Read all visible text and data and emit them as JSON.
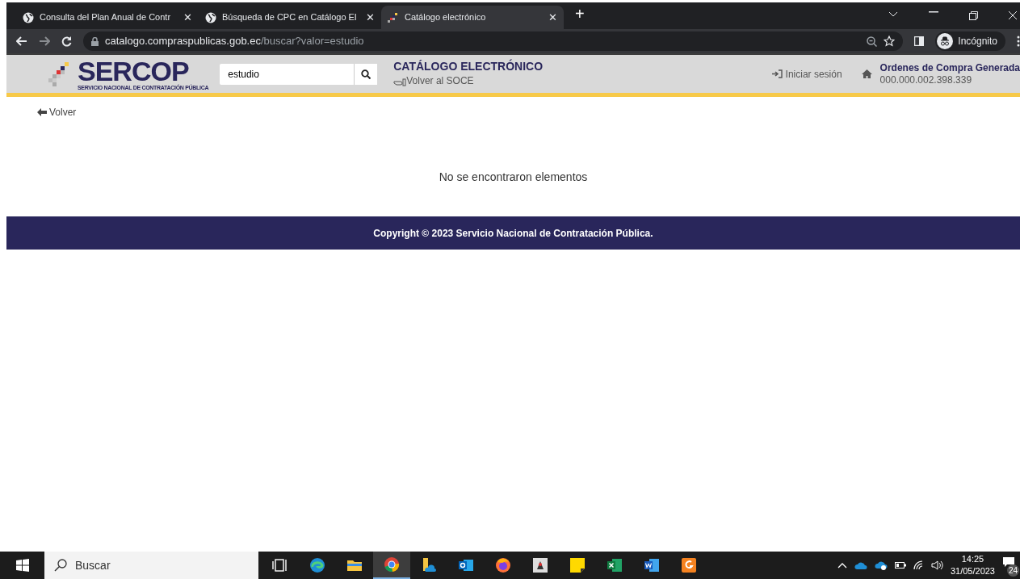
{
  "browser": {
    "tabs": [
      {
        "title": "Consulta del Plan Anual de Contr",
        "close": "✕",
        "selected": false
      },
      {
        "title": "Búsqueda de CPC en Catálogo El",
        "close": "✕",
        "selected": false
      },
      {
        "title": "Catálogo electrónico",
        "close": "✕",
        "selected": true
      }
    ],
    "new_tab": "+",
    "url_host": "catalogo.compraspublicas.gob.ec",
    "url_path": "/buscar?valor=estudio",
    "profile": "Incógnito"
  },
  "header": {
    "logo": "SERCOP",
    "logo_subtitle": "SERVICIO NACIONAL DE CONTRATACIÓN PÚBLICA",
    "search": {
      "value": "estudio"
    },
    "title": "CATÁLOGO ELECTRÓNICO",
    "back_link": "Volver al SOCE",
    "login": "Iniciar sesión",
    "orders_label": "Ordenes de Compra Generada",
    "orders_value": "000.000.002.398.339"
  },
  "back": "Volver",
  "message": "No se encontraron elementos",
  "footer": "Copyright © 2023 Servicio Nacional de Contratación Pública.",
  "taskbar": {
    "search_placeholder": "Buscar",
    "apps": [
      {
        "kind": "taskview",
        "selected": false
      },
      {
        "kind": "edge",
        "selected": false
      },
      {
        "kind": "folder",
        "selected": false
      },
      {
        "kind": "chrome",
        "selected": true
      },
      {
        "kind": "cloudfolder",
        "selected": false
      },
      {
        "kind": "outlook",
        "selected": false
      },
      {
        "kind": "firefox",
        "selected": false
      },
      {
        "kind": "java",
        "selected": false
      },
      {
        "kind": "notes",
        "selected": false
      },
      {
        "kind": "excel",
        "selected": false
      },
      {
        "kind": "word",
        "selected": false
      },
      {
        "kind": "pdf",
        "selected": false
      }
    ],
    "time": "14:25",
    "date": "31/05/2023",
    "notifications": "24"
  }
}
